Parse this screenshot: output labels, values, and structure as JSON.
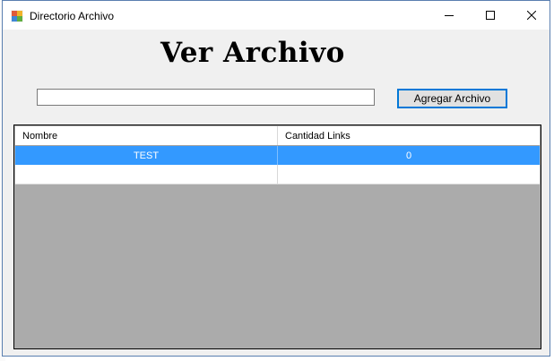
{
  "window": {
    "title": "Directorio Archivo",
    "controls": {
      "minimize": "—",
      "maximize": "☐",
      "close": "✕"
    }
  },
  "form": {
    "heading": "Ver Archivo",
    "path_input": {
      "value": "",
      "placeholder": ""
    },
    "add_button_label": "Agregar Archivo"
  },
  "grid": {
    "columns": [
      "Nombre",
      "Cantidad Links"
    ],
    "rows": [
      {
        "nombre": "TEST",
        "cantidad_links": "0",
        "selected": true
      }
    ]
  },
  "colors": {
    "selection": "#3399ff",
    "grid_background": "#ababab",
    "window_background": "#f0f0f0",
    "button_border": "#0078d7"
  }
}
